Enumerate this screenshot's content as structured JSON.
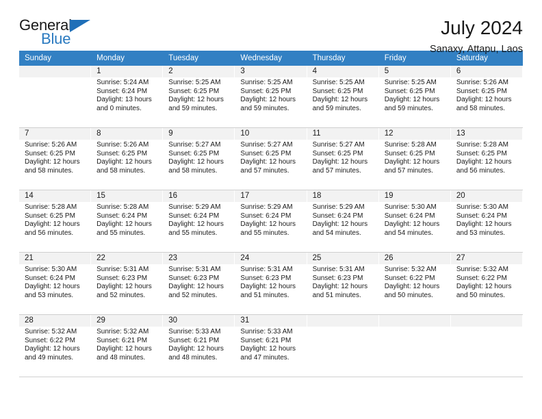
{
  "brand": {
    "name_part1": "General",
    "name_part2": "Blue",
    "triangle_color": "#1f6fb8",
    "blue_color": "#2a7ac0"
  },
  "header": {
    "title": "July 2024",
    "location": "Sanaxy, Attapu, Laos"
  },
  "calendar": {
    "header_bg": "#3280c3",
    "daynum_bg": "#f2f2f2",
    "weekdays": [
      "Sunday",
      "Monday",
      "Tuesday",
      "Wednesday",
      "Thursday",
      "Friday",
      "Saturday"
    ],
    "weeks": [
      [
        {
          "day": "",
          "sunrise": "",
          "sunset": "",
          "daylight_line1": "",
          "daylight_line2": ""
        },
        {
          "day": "1",
          "sunrise": "Sunrise: 5:24 AM",
          "sunset": "Sunset: 6:24 PM",
          "daylight_line1": "Daylight: 13 hours",
          "daylight_line2": "and 0 minutes."
        },
        {
          "day": "2",
          "sunrise": "Sunrise: 5:25 AM",
          "sunset": "Sunset: 6:25 PM",
          "daylight_line1": "Daylight: 12 hours",
          "daylight_line2": "and 59 minutes."
        },
        {
          "day": "3",
          "sunrise": "Sunrise: 5:25 AM",
          "sunset": "Sunset: 6:25 PM",
          "daylight_line1": "Daylight: 12 hours",
          "daylight_line2": "and 59 minutes."
        },
        {
          "day": "4",
          "sunrise": "Sunrise: 5:25 AM",
          "sunset": "Sunset: 6:25 PM",
          "daylight_line1": "Daylight: 12 hours",
          "daylight_line2": "and 59 minutes."
        },
        {
          "day": "5",
          "sunrise": "Sunrise: 5:25 AM",
          "sunset": "Sunset: 6:25 PM",
          "daylight_line1": "Daylight: 12 hours",
          "daylight_line2": "and 59 minutes."
        },
        {
          "day": "6",
          "sunrise": "Sunrise: 5:26 AM",
          "sunset": "Sunset: 6:25 PM",
          "daylight_line1": "Daylight: 12 hours",
          "daylight_line2": "and 58 minutes."
        }
      ],
      [
        {
          "day": "7",
          "sunrise": "Sunrise: 5:26 AM",
          "sunset": "Sunset: 6:25 PM",
          "daylight_line1": "Daylight: 12 hours",
          "daylight_line2": "and 58 minutes."
        },
        {
          "day": "8",
          "sunrise": "Sunrise: 5:26 AM",
          "sunset": "Sunset: 6:25 PM",
          "daylight_line1": "Daylight: 12 hours",
          "daylight_line2": "and 58 minutes."
        },
        {
          "day": "9",
          "sunrise": "Sunrise: 5:27 AM",
          "sunset": "Sunset: 6:25 PM",
          "daylight_line1": "Daylight: 12 hours",
          "daylight_line2": "and 58 minutes."
        },
        {
          "day": "10",
          "sunrise": "Sunrise: 5:27 AM",
          "sunset": "Sunset: 6:25 PM",
          "daylight_line1": "Daylight: 12 hours",
          "daylight_line2": "and 57 minutes."
        },
        {
          "day": "11",
          "sunrise": "Sunrise: 5:27 AM",
          "sunset": "Sunset: 6:25 PM",
          "daylight_line1": "Daylight: 12 hours",
          "daylight_line2": "and 57 minutes."
        },
        {
          "day": "12",
          "sunrise": "Sunrise: 5:28 AM",
          "sunset": "Sunset: 6:25 PM",
          "daylight_line1": "Daylight: 12 hours",
          "daylight_line2": "and 57 minutes."
        },
        {
          "day": "13",
          "sunrise": "Sunrise: 5:28 AM",
          "sunset": "Sunset: 6:25 PM",
          "daylight_line1": "Daylight: 12 hours",
          "daylight_line2": "and 56 minutes."
        }
      ],
      [
        {
          "day": "14",
          "sunrise": "Sunrise: 5:28 AM",
          "sunset": "Sunset: 6:25 PM",
          "daylight_line1": "Daylight: 12 hours",
          "daylight_line2": "and 56 minutes."
        },
        {
          "day": "15",
          "sunrise": "Sunrise: 5:28 AM",
          "sunset": "Sunset: 6:24 PM",
          "daylight_line1": "Daylight: 12 hours",
          "daylight_line2": "and 55 minutes."
        },
        {
          "day": "16",
          "sunrise": "Sunrise: 5:29 AM",
          "sunset": "Sunset: 6:24 PM",
          "daylight_line1": "Daylight: 12 hours",
          "daylight_line2": "and 55 minutes."
        },
        {
          "day": "17",
          "sunrise": "Sunrise: 5:29 AM",
          "sunset": "Sunset: 6:24 PM",
          "daylight_line1": "Daylight: 12 hours",
          "daylight_line2": "and 55 minutes."
        },
        {
          "day": "18",
          "sunrise": "Sunrise: 5:29 AM",
          "sunset": "Sunset: 6:24 PM",
          "daylight_line1": "Daylight: 12 hours",
          "daylight_line2": "and 54 minutes."
        },
        {
          "day": "19",
          "sunrise": "Sunrise: 5:30 AM",
          "sunset": "Sunset: 6:24 PM",
          "daylight_line1": "Daylight: 12 hours",
          "daylight_line2": "and 54 minutes."
        },
        {
          "day": "20",
          "sunrise": "Sunrise: 5:30 AM",
          "sunset": "Sunset: 6:24 PM",
          "daylight_line1": "Daylight: 12 hours",
          "daylight_line2": "and 53 minutes."
        }
      ],
      [
        {
          "day": "21",
          "sunrise": "Sunrise: 5:30 AM",
          "sunset": "Sunset: 6:24 PM",
          "daylight_line1": "Daylight: 12 hours",
          "daylight_line2": "and 53 minutes."
        },
        {
          "day": "22",
          "sunrise": "Sunrise: 5:31 AM",
          "sunset": "Sunset: 6:23 PM",
          "daylight_line1": "Daylight: 12 hours",
          "daylight_line2": "and 52 minutes."
        },
        {
          "day": "23",
          "sunrise": "Sunrise: 5:31 AM",
          "sunset": "Sunset: 6:23 PM",
          "daylight_line1": "Daylight: 12 hours",
          "daylight_line2": "and 52 minutes."
        },
        {
          "day": "24",
          "sunrise": "Sunrise: 5:31 AM",
          "sunset": "Sunset: 6:23 PM",
          "daylight_line1": "Daylight: 12 hours",
          "daylight_line2": "and 51 minutes."
        },
        {
          "day": "25",
          "sunrise": "Sunrise: 5:31 AM",
          "sunset": "Sunset: 6:23 PM",
          "daylight_line1": "Daylight: 12 hours",
          "daylight_line2": "and 51 minutes."
        },
        {
          "day": "26",
          "sunrise": "Sunrise: 5:32 AM",
          "sunset": "Sunset: 6:22 PM",
          "daylight_line1": "Daylight: 12 hours",
          "daylight_line2": "and 50 minutes."
        },
        {
          "day": "27",
          "sunrise": "Sunrise: 5:32 AM",
          "sunset": "Sunset: 6:22 PM",
          "daylight_line1": "Daylight: 12 hours",
          "daylight_line2": "and 50 minutes."
        }
      ],
      [
        {
          "day": "28",
          "sunrise": "Sunrise: 5:32 AM",
          "sunset": "Sunset: 6:22 PM",
          "daylight_line1": "Daylight: 12 hours",
          "daylight_line2": "and 49 minutes."
        },
        {
          "day": "29",
          "sunrise": "Sunrise: 5:32 AM",
          "sunset": "Sunset: 6:21 PM",
          "daylight_line1": "Daylight: 12 hours",
          "daylight_line2": "and 48 minutes."
        },
        {
          "day": "30",
          "sunrise": "Sunrise: 5:33 AM",
          "sunset": "Sunset: 6:21 PM",
          "daylight_line1": "Daylight: 12 hours",
          "daylight_line2": "and 48 minutes."
        },
        {
          "day": "31",
          "sunrise": "Sunrise: 5:33 AM",
          "sunset": "Sunset: 6:21 PM",
          "daylight_line1": "Daylight: 12 hours",
          "daylight_line2": "and 47 minutes."
        },
        {
          "day": "",
          "sunrise": "",
          "sunset": "",
          "daylight_line1": "",
          "daylight_line2": ""
        },
        {
          "day": "",
          "sunrise": "",
          "sunset": "",
          "daylight_line1": "",
          "daylight_line2": ""
        },
        {
          "day": "",
          "sunrise": "",
          "sunset": "",
          "daylight_line1": "",
          "daylight_line2": ""
        }
      ]
    ]
  }
}
